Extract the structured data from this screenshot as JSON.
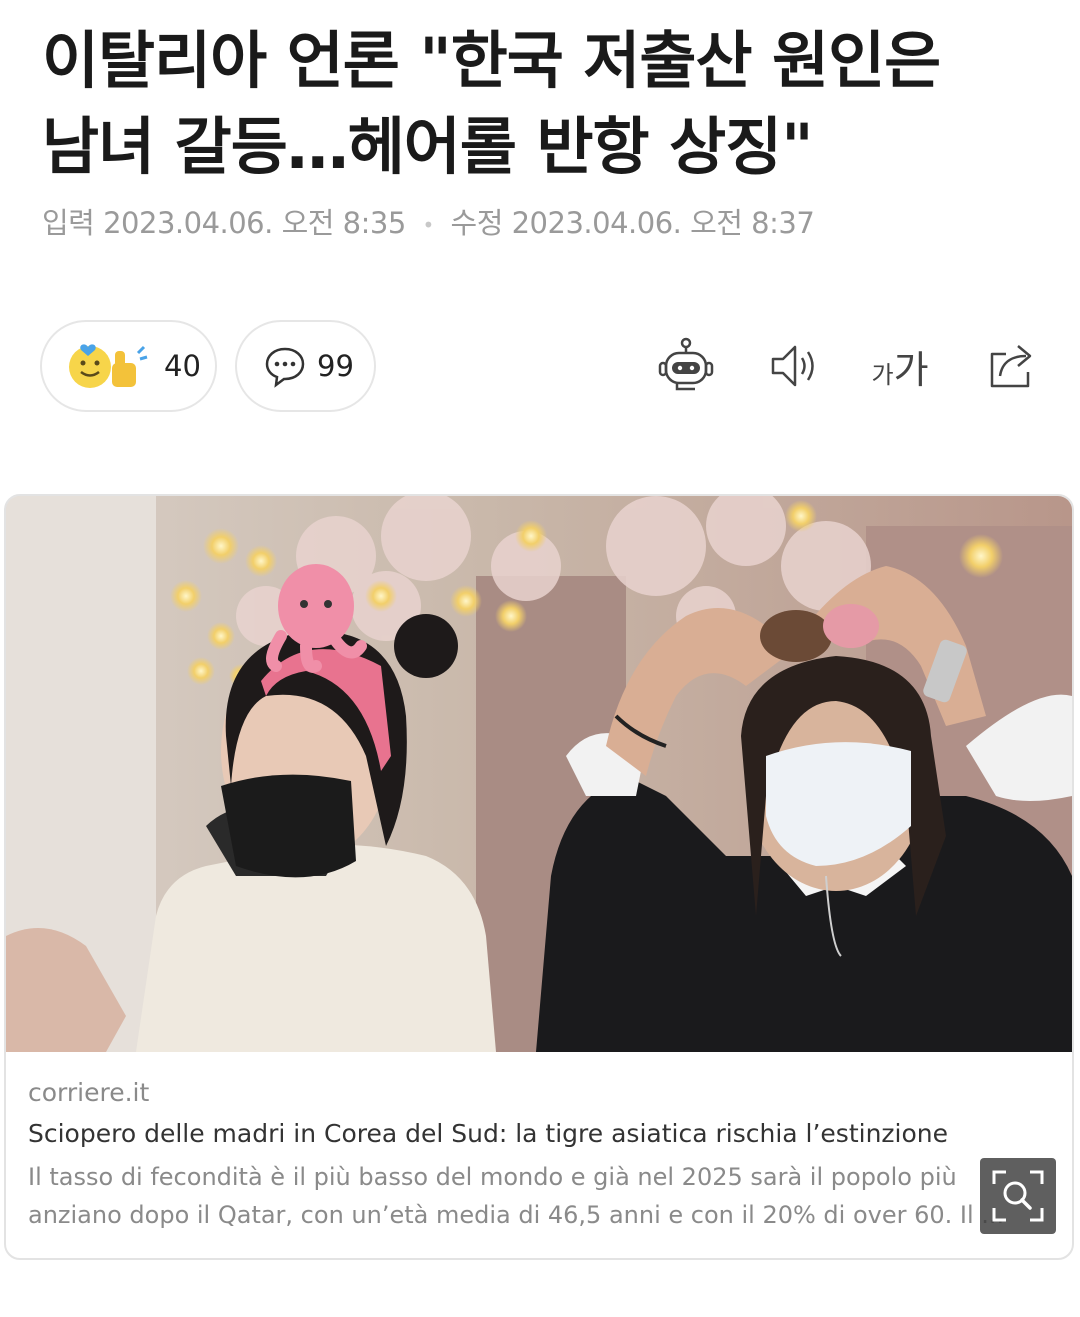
{
  "article": {
    "headline_line1": "이탈리아 언론 \"한국 저출산 원인은",
    "headline_line2": "남녀 갈등…헤어롤 반항 상징\"",
    "input_label": "입력",
    "input_time": "2023.04.06. 오전 8:35",
    "edit_label": "수정",
    "edit_time": "2023.04.06. 오전 8:37"
  },
  "actions": {
    "reaction_count": "40",
    "comment_count": "99"
  },
  "toolbar": {
    "icons": [
      "robot-summary-icon",
      "speaker-icon",
      "font-size-icon",
      "share-icon"
    ],
    "font_small": "가",
    "font_large": "가"
  },
  "link_card": {
    "source": "corriere.it",
    "title": "Sciopero delle madri in Corea del Sud: la tigre asiatica rischia l’estinzione",
    "description": "Il tasso di fecondità è il più basso del mondo e già nel 2025 sarà il popolo più anziano dopo il Qatar, con un’età media di 46,5 anni e con il 20% di over 60. Il ..."
  },
  "colors": {
    "headline": "#1a1a1a",
    "meta": "#9a9a9a",
    "border": "#e6e6e6",
    "headband": "#e8738f"
  }
}
